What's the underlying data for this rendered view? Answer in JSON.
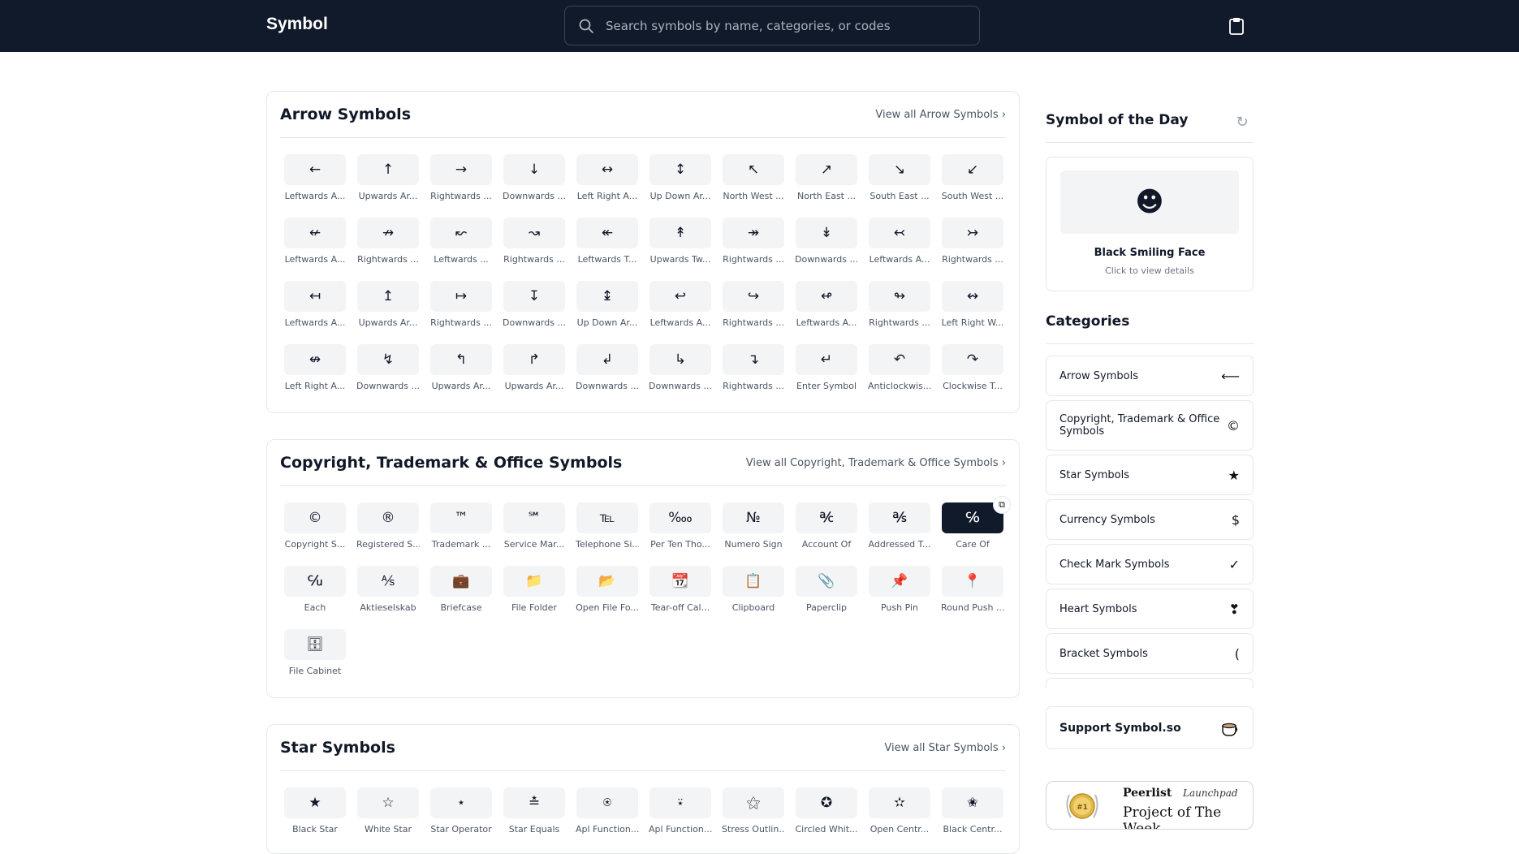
{
  "header": {
    "logo": "Symbol",
    "search_placeholder": "Search symbols by name, categories, or codes"
  },
  "sections": [
    {
      "title": "Arrow Symbols",
      "view_all": "View all Arrow Symbols",
      "items": [
        {
          "glyph": "←",
          "label": "Leftwards A..."
        },
        {
          "glyph": "↑",
          "label": "Upwards Ar..."
        },
        {
          "glyph": "→",
          "label": "Rightwards ..."
        },
        {
          "glyph": "↓",
          "label": "Downwards ..."
        },
        {
          "glyph": "↔",
          "label": "Left Right A..."
        },
        {
          "glyph": "↕",
          "label": "Up Down Ar..."
        },
        {
          "glyph": "↖",
          "label": "North West ..."
        },
        {
          "glyph": "↗",
          "label": "North East ..."
        },
        {
          "glyph": "↘",
          "label": "South East ..."
        },
        {
          "glyph": "↙",
          "label": "South West ..."
        },
        {
          "glyph": "↚",
          "label": "Leftwards A..."
        },
        {
          "glyph": "↛",
          "label": "Rightwards ..."
        },
        {
          "glyph": "↜",
          "label": "Leftwards ..."
        },
        {
          "glyph": "↝",
          "label": "Rightwards ..."
        },
        {
          "glyph": "↞",
          "label": "Leftwards T..."
        },
        {
          "glyph": "↟",
          "label": "Upwards Tw..."
        },
        {
          "glyph": "↠",
          "label": "Rightwards ..."
        },
        {
          "glyph": "↡",
          "label": "Downwards ..."
        },
        {
          "glyph": "↢",
          "label": "Leftwards A..."
        },
        {
          "glyph": "↣",
          "label": "Rightwards ..."
        },
        {
          "glyph": "↤",
          "label": "Leftwards A..."
        },
        {
          "glyph": "↥",
          "label": "Upwards Ar..."
        },
        {
          "glyph": "↦",
          "label": "Rightwards ..."
        },
        {
          "glyph": "↧",
          "label": "Downwards ..."
        },
        {
          "glyph": "↨",
          "label": "Up Down Ar..."
        },
        {
          "glyph": "↩",
          "label": "Leftwards A..."
        },
        {
          "glyph": "↪",
          "label": "Rightwards ..."
        },
        {
          "glyph": "↫",
          "label": "Leftwards A..."
        },
        {
          "glyph": "↬",
          "label": "Rightwards ..."
        },
        {
          "glyph": "↭",
          "label": "Left Right W..."
        },
        {
          "glyph": "↮",
          "label": "Left Right A..."
        },
        {
          "glyph": "↯",
          "label": "Downwards ..."
        },
        {
          "glyph": "↰",
          "label": "Upwards Ar..."
        },
        {
          "glyph": "↱",
          "label": "Upwards Ar..."
        },
        {
          "glyph": "↲",
          "label": "Downwards ..."
        },
        {
          "glyph": "↳",
          "label": "Downwards ..."
        },
        {
          "glyph": "↴",
          "label": "Rightwards ..."
        },
        {
          "glyph": "↵",
          "label": "Enter Symbol"
        },
        {
          "glyph": "↶",
          "label": "Anticlockwis..."
        },
        {
          "glyph": "↷",
          "label": "Clockwise T..."
        }
      ]
    },
    {
      "title": "Copyright, Trademark & Office Symbols",
      "view_all": "View all Copyright, Trademark & Office Symbols",
      "items": [
        {
          "glyph": "©",
          "label": "Copyright S..."
        },
        {
          "glyph": "®",
          "label": "Registered S..."
        },
        {
          "glyph": "™",
          "label": "Trademark ..."
        },
        {
          "glyph": "℠",
          "label": "Service Mar..."
        },
        {
          "glyph": "℡",
          "label": "Telephone Si..."
        },
        {
          "glyph": "‱",
          "label": "Per Ten Tho..."
        },
        {
          "glyph": "№",
          "label": "Numero Sign"
        },
        {
          "glyph": "℀",
          "label": "Account Of"
        },
        {
          "glyph": "℁",
          "label": "Addressed T..."
        },
        {
          "glyph": "℅",
          "label": "Care Of",
          "selected": true
        },
        {
          "glyph": "℆",
          "label": "Each"
        },
        {
          "glyph": "⅍",
          "label": "Aktieselskab"
        },
        {
          "glyph": "💼",
          "label": "Briefcase"
        },
        {
          "glyph": "📁",
          "label": "File Folder"
        },
        {
          "glyph": "📂",
          "label": "Open File Fo..."
        },
        {
          "glyph": "📆",
          "label": "Tear-off Cal..."
        },
        {
          "glyph": "📋",
          "label": "Clipboard"
        },
        {
          "glyph": "📎",
          "label": "Paperclip"
        },
        {
          "glyph": "📌",
          "label": "Push Pin"
        },
        {
          "glyph": "📍",
          "label": "Round Push ..."
        },
        {
          "glyph": "🗄",
          "label": "File Cabinet"
        }
      ]
    },
    {
      "title": "Star Symbols",
      "view_all": "View all Star Symbols",
      "items": [
        {
          "glyph": "★",
          "label": "Black Star"
        },
        {
          "glyph": "☆",
          "label": "White Star"
        },
        {
          "glyph": "⋆",
          "label": "Star Operator"
        },
        {
          "glyph": "≛",
          "label": "Star Equals"
        },
        {
          "glyph": "⍟",
          "label": "Apl Function..."
        },
        {
          "glyph": "⍣",
          "label": "Apl Function..."
        },
        {
          "glyph": "⚝",
          "label": "Stress Outlin..."
        },
        {
          "glyph": "✪",
          "label": "Circled Whit..."
        },
        {
          "glyph": "✫",
          "label": "Open Centr..."
        },
        {
          "glyph": "✬",
          "label": "Black Centr..."
        }
      ]
    }
  ],
  "sidebar": {
    "sotd_title": "Symbol of the Day",
    "sotd_glyph": "☻",
    "sotd_name": "Black Smiling Face",
    "sotd_sub": "Click to view details",
    "categories_title": "Categories",
    "categories": [
      {
        "label": "Arrow Symbols",
        "icon": "⟵"
      },
      {
        "label": "Copyright, Trademark & Office Symbols",
        "icon": "©"
      },
      {
        "label": "Star Symbols",
        "icon": "★"
      },
      {
        "label": "Currency Symbols",
        "icon": "$"
      },
      {
        "label": "Check Mark Symbols",
        "icon": "✓"
      },
      {
        "label": "Heart Symbols",
        "icon": "❣"
      },
      {
        "label": "Bracket Symbols",
        "icon": "("
      },
      {
        "label": "",
        "icon": ""
      }
    ],
    "support": "Support Symbol.so",
    "peerlist_name": "Peerlist",
    "peerlist_launch": "Launchpad",
    "peerlist_week": "Project of The Week",
    "medal_text": "#1"
  }
}
